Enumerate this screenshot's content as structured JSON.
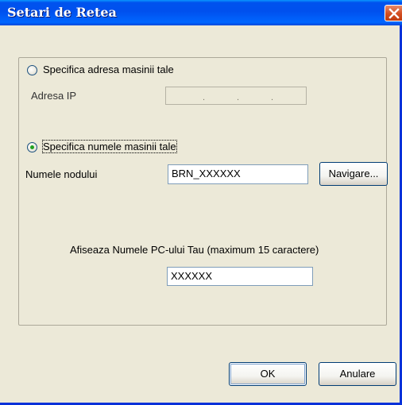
{
  "window": {
    "title": "Setari de Retea",
    "close_icon": "close-icon"
  },
  "address_option": {
    "label": "Specifica adresa masinii tale",
    "selected": false,
    "ip_label": "Adresa IP",
    "ip_value": "",
    "ip_dots": [
      ".",
      ".",
      "."
    ]
  },
  "name_option": {
    "label": "Specifica numele masinii tale",
    "selected": true,
    "node_label": "Numele nodului",
    "node_value": "BRN_XXXXXX",
    "browse_label": "Navigare..."
  },
  "pc_name": {
    "label": "Afiseaza Numele PC-ului Tau (maximum 15 caractere)",
    "value": "XXXXXX"
  },
  "buttons": {
    "ok": "OK",
    "cancel": "Anulare"
  },
  "colors": {
    "titlebar": "#0053ee",
    "dialog_bg": "#ece9d8",
    "close_button": "#d24d20",
    "radio_dot": "#21a121"
  }
}
